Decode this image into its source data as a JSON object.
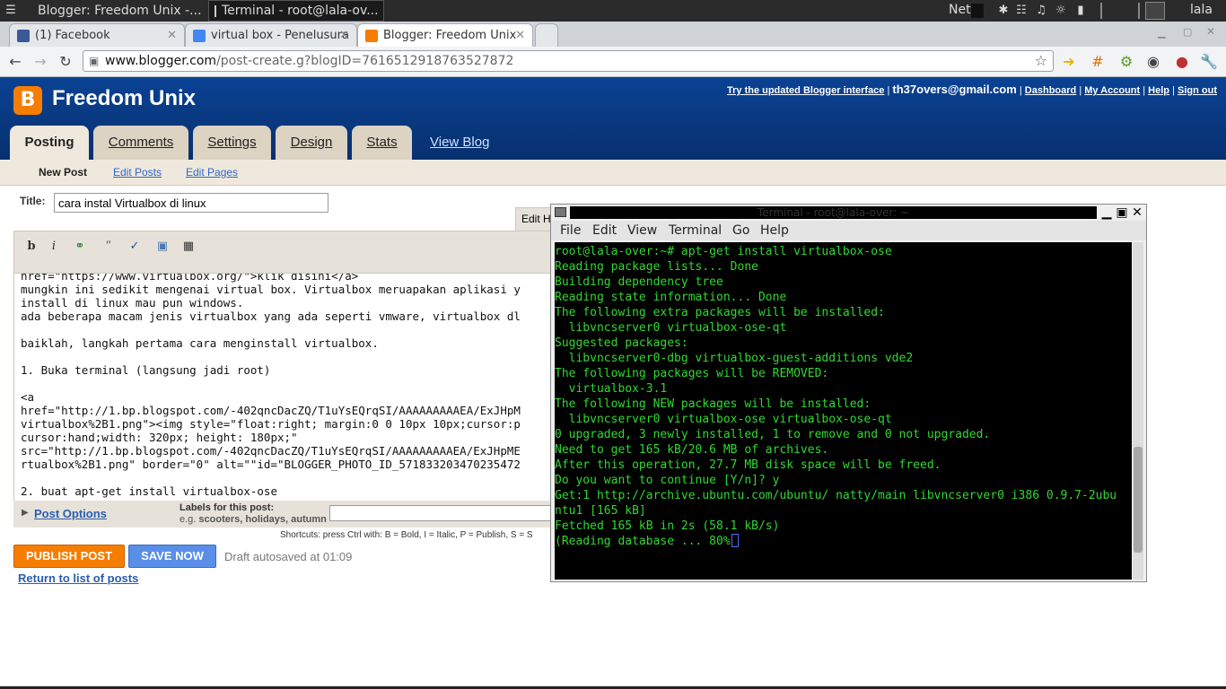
{
  "panel": {
    "tasks": [
      {
        "label": "Blogger: Freedom Unix -..."
      },
      {
        "label": "Terminal - root@lala-ov..."
      }
    ],
    "net_label": "Net",
    "clock": "",
    "user": "lala"
  },
  "browser": {
    "tabs": [
      {
        "label": "(1) Facebook",
        "color": "#3b5998"
      },
      {
        "label": "virtual box - Penelusura",
        "color": "#4285f4"
      },
      {
        "label": "Blogger: Freedom Unix",
        "color": "#f57d00"
      }
    ],
    "url_host": "www.blogger.com",
    "url_path": "/post-create.g?blogID=7616512918763527872"
  },
  "blogger": {
    "blog_title": "Freedom Unix",
    "links": {
      "try_updated": "Try the updated Blogger interface",
      "email": "th37overs@gmail.com",
      "dashboard": "Dashboard",
      "my_account": "My Account",
      "help": "Help",
      "sign_out": "Sign out"
    },
    "tabs": [
      {
        "label": "Posting"
      },
      {
        "label": "Comments"
      },
      {
        "label": "Settings"
      },
      {
        "label": "Design"
      },
      {
        "label": "Stats"
      }
    ],
    "view_blog": "View Blog",
    "subnav": [
      {
        "label": "New Post"
      },
      {
        "label": "Edit Posts"
      },
      {
        "label": "Edit Pages"
      }
    ],
    "title_label": "Title:",
    "title_value": "cara instal Virtualbox di linux",
    "edit_html_tab": "Edit H",
    "editor_lines": [
      "href=\"https://www.virtualbox.org/\">klik disini</a>",
      "mungkin ini sedikit mengenai virtual box. Virtualbox meruapakan aplikasi y",
      "install di linux mau pun windows.",
      "ada beberapa macam jenis virtualbox yang ada seperti vmware, virtualbox dl",
      "",
      "baiklah, langkah pertama cara menginstall virtualbox.",
      "",
      "1. Buka terminal (langsung jadi root)",
      "",
      "<a",
      "href=\"http://1.bp.blogspot.com/-402qncDacZQ/T1uYsEQrqSI/AAAAAAAAAEA/ExJHpM",
      "virtualbox%2B1.png\"><img style=\"float:right; margin:0 0 10px 10px;cursor:p",
      "cursor:hand;width: 320px; height: 180px;\"",
      "src=\"http://1.bp.blogspot.com/-402qncDacZQ/T1uYsEQrqSI/AAAAAAAAAEA/ExJHpME",
      "rtualbox%2B1.png\" border=\"0\" alt=\"\"id=\"BLOGGER_PHOTO_ID_571833203470235472",
      "",
      "2. buat apt-get install virtualbox-ose"
    ],
    "post_options": "Post Options",
    "labels_title": "Labels for this post:",
    "labels_eg_prefix": "e.g.",
    "labels_example": "scooters, holidays, autumn",
    "shortcuts": "Shortcuts: press Ctrl with: B = Bold, I = Italic, P = Publish, S = S",
    "publish": "PUBLISH POST",
    "save": "SAVE NOW",
    "autosave": "Draft autosaved at 01:09",
    "return": "Return to list of posts"
  },
  "terminal": {
    "title": "Terminal - root@lala-over: ~",
    "menu": [
      {
        "label": "File"
      },
      {
        "label": "Edit"
      },
      {
        "label": "View"
      },
      {
        "label": "Terminal"
      },
      {
        "label": "Go"
      },
      {
        "label": "Help"
      }
    ],
    "lines": [
      "root@lala-over:~# apt-get install virtualbox-ose",
      "Reading package lists... Done",
      "Building dependency tree",
      "Reading state information... Done",
      "The following extra packages will be installed:",
      "  libvncserver0 virtualbox-ose-qt",
      "Suggested packages:",
      "  libvncserver0-dbg virtualbox-guest-additions vde2",
      "The following packages will be REMOVED:",
      "  virtualbox-3.1",
      "The following NEW packages will be installed:",
      "  libvncserver0 virtualbox-ose virtualbox-ose-qt",
      "0 upgraded, 3 newly installed, 1 to remove and 0 not upgraded.",
      "Need to get 165 kB/20.6 MB of archives.",
      "After this operation, 27.7 MB disk space will be freed.",
      "Do you want to continue [Y/n]? y",
      "Get:1 http://archive.ubuntu.com/ubuntu/ natty/main libvncserver0 i386 0.9.7-2ubu",
      "ntu1 [165 kB]",
      "Fetched 165 kB in 2s (58.1 kB/s)",
      "(Reading database ... 80%"
    ]
  }
}
